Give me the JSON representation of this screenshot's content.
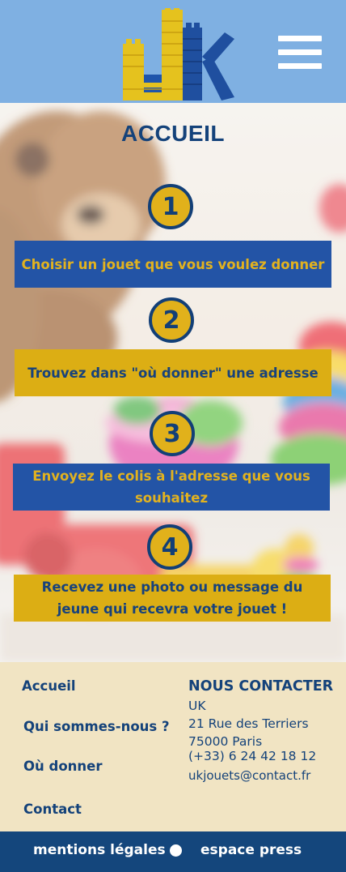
{
  "header": {
    "logo_alt": "UK",
    "menu_icon": "hamburger-menu-icon"
  },
  "page": {
    "title": "ACCUEIL"
  },
  "steps": [
    {
      "number": "1",
      "text": "Choisir un jouet que vous voulez donner"
    },
    {
      "number": "2",
      "text": "Trouvez dans \"où donner\" une adresse"
    },
    {
      "number": "3",
      "text": "Envoyez le colis à l'adresse que vous souhaitez"
    },
    {
      "number": "4",
      "text": "Recevez une photo ou message du jeune qui recevra votre jouet !"
    }
  ],
  "footer": {
    "links": [
      "Accueil",
      "Qui sommes-nous ?",
      "Où donner",
      "Contact"
    ],
    "contact": {
      "title": "NOUS CONTACTER",
      "name": "UK",
      "street": "21 Rue des Terriers",
      "city": "75000 Paris",
      "phone": "(+33) 6 24 42 18 12",
      "email": "ukjouets@contact.fr"
    }
  },
  "bottom_bar": {
    "legal": "mentions légales",
    "press": "espace press"
  },
  "colors": {
    "header_bg": "#7fb0e2",
    "navy": "#14427a",
    "yellow": "#dcae14",
    "blue": "#2354a6",
    "footer_bg": "#f1e4c3"
  }
}
